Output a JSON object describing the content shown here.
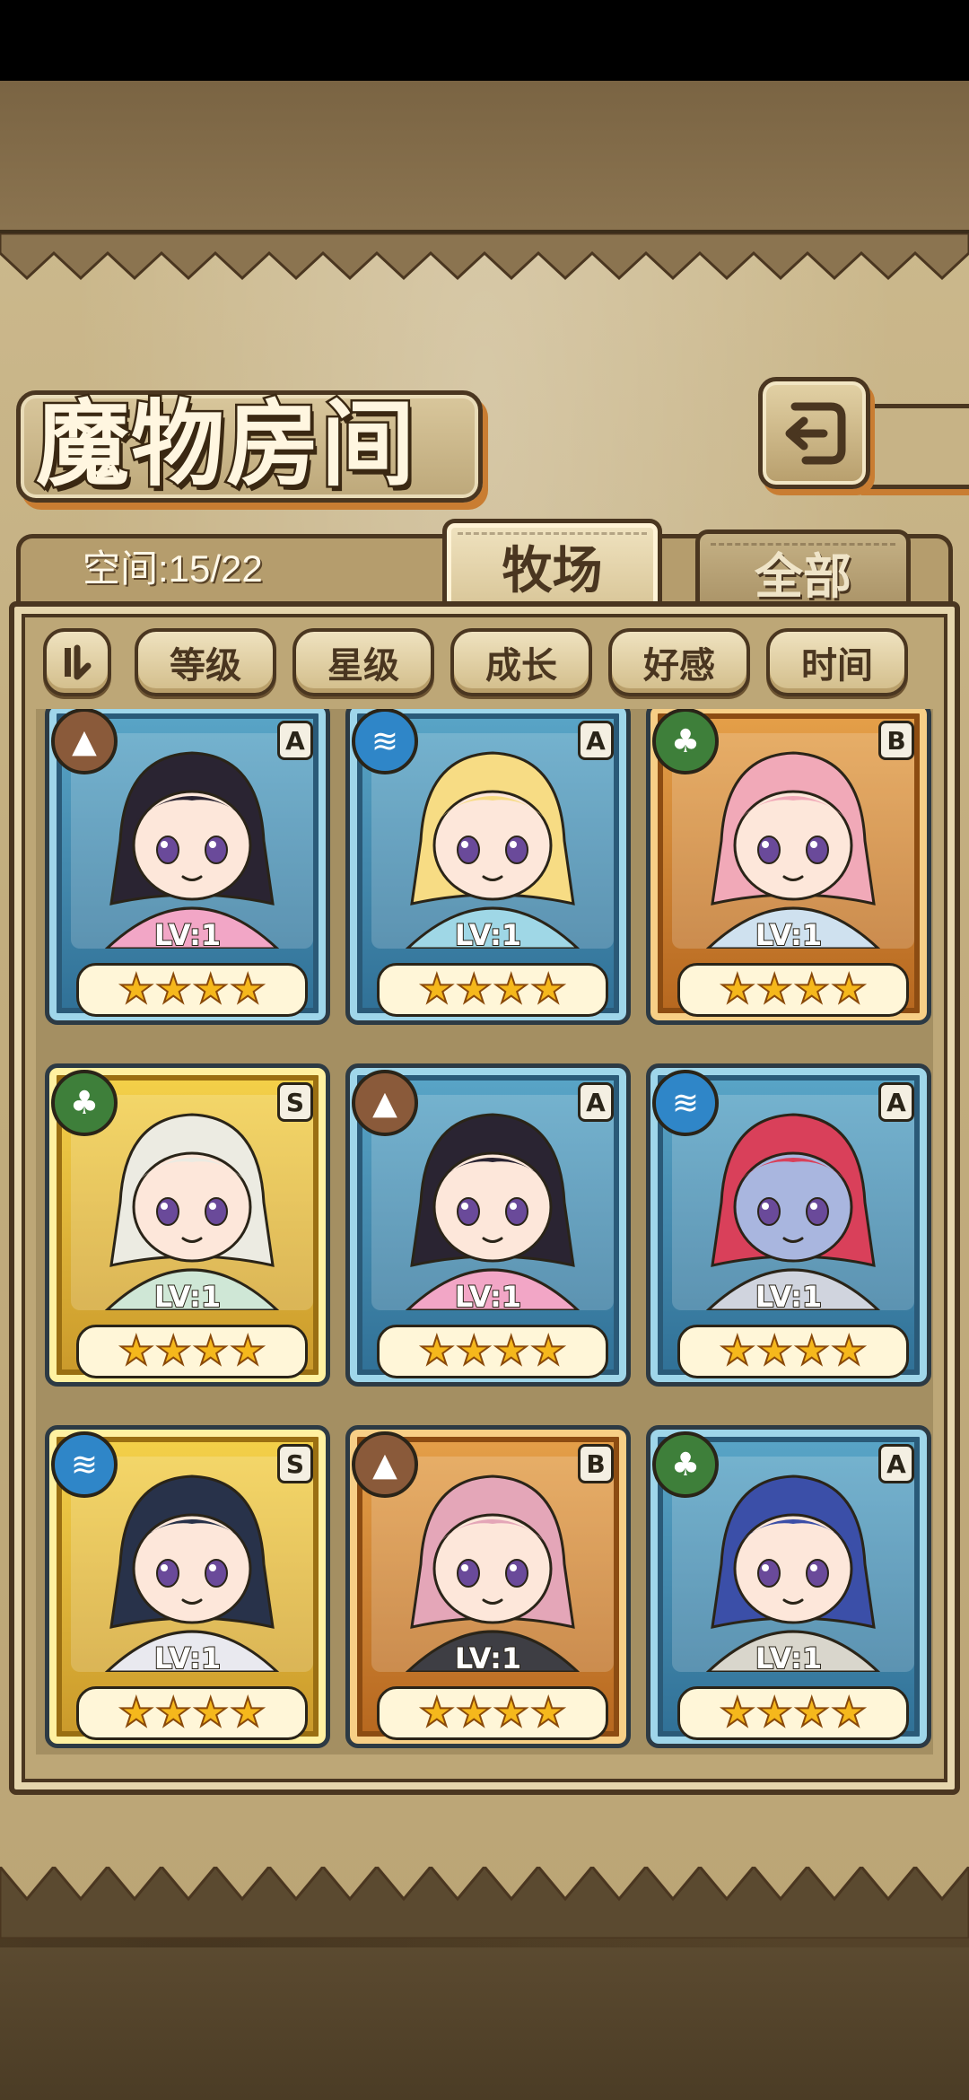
{
  "title": "魔物房间",
  "space": {
    "label": "空间:15/22"
  },
  "tabs": [
    {
      "label": "牧场",
      "active": true
    },
    {
      "label": "全部",
      "active": false
    }
  ],
  "sort_buttons": [
    {
      "label": "等级"
    },
    {
      "label": "星级"
    },
    {
      "label": "成长"
    },
    {
      "label": "好感"
    },
    {
      "label": "时间"
    }
  ],
  "colors": {
    "accent_orange": "#c97d32",
    "border_brown": "#4a3620",
    "parchment": "#c2ad7e"
  },
  "monsters": [
    {
      "element": "earth-icon",
      "rank": "A",
      "level": "LV:1",
      "stars": 4,
      "frame": "blue",
      "hair": "#2a2432",
      "skin": "#fde7da",
      "outfit": "#f2a6c6"
    },
    {
      "element": "water-icon",
      "rank": "A",
      "level": "LV:1",
      "stars": 4,
      "frame": "blue",
      "hair": "#f7dc84",
      "skin": "#fde7da",
      "outfit": "#9fd7e6"
    },
    {
      "element": "leaf-icon",
      "rank": "B",
      "level": "LV:1",
      "stars": 4,
      "frame": "orange",
      "hair": "#f1a9b8",
      "skin": "#fde7da",
      "outfit": "#cfe1ef"
    },
    {
      "element": "leaf-icon",
      "rank": "S",
      "level": "LV:1",
      "stars": 4,
      "frame": "gold",
      "hair": "#ecebe2",
      "skin": "#fde7da",
      "outfit": "#cfe7d6"
    },
    {
      "element": "earth-icon",
      "rank": "A",
      "level": "LV:1",
      "stars": 4,
      "frame": "blue",
      "hair": "#2a2432",
      "skin": "#fde7da",
      "outfit": "#f2a6c6"
    },
    {
      "element": "water-icon",
      "rank": "A",
      "level": "LV:1",
      "stars": 4,
      "frame": "blue",
      "hair": "#d9405a",
      "skin": "#a9b6df",
      "outfit": "#d0d4de"
    },
    {
      "element": "water-icon",
      "rank": "S",
      "level": "LV:1",
      "stars": 4,
      "frame": "gold",
      "hair": "#28324a",
      "skin": "#fde7da",
      "outfit": "#e9e9ef"
    },
    {
      "element": "earth-icon",
      "rank": "B",
      "level": "LV:1",
      "stars": 4,
      "frame": "orange",
      "hair": "#e4a6b8",
      "skin": "#fde7da",
      "outfit": "#3e3e44"
    },
    {
      "element": "leaf-icon",
      "rank": "A",
      "level": "LV:1",
      "stars": 4,
      "frame": "blue",
      "hair": "#3b4fa8",
      "skin": "#fde7da",
      "outfit": "#d9d6cc"
    }
  ]
}
